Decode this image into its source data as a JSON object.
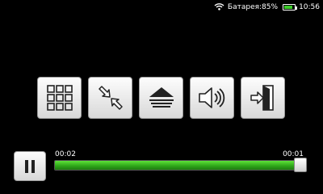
{
  "status_bar": {
    "battery_label": "Батарея:85%",
    "battery_level": 0.85,
    "clock": "10:56",
    "icons": [
      "wifi-icon",
      "battery-icon"
    ]
  },
  "controls": {
    "buttons": [
      "grid-menu-button",
      "exit-fullscreen-button",
      "eject-button",
      "volume-button",
      "exit-button"
    ]
  },
  "playback": {
    "elapsed": "00:02",
    "remaining": "00:01",
    "progress": 0.98,
    "pause_icon": "pause-icon",
    "accent_color": "#3ccc2a"
  }
}
